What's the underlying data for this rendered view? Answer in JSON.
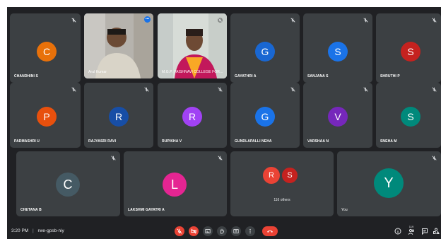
{
  "participants": [
    {
      "name": "CHANDHINI S",
      "initial": "C",
      "color": "#e8710a"
    },
    {
      "name": "Arul Kumar",
      "video": true
    },
    {
      "name": "M.G.P. VAISHNAVI COLLEGE FOR...",
      "video": true
    },
    {
      "name": "GAYATHRI A",
      "initial": "G",
      "color": "#1967d2"
    },
    {
      "name": "SANJANA S",
      "initial": "S",
      "color": "#1a73e8"
    },
    {
      "name": "SHRUTHI P",
      "initial": "S",
      "color": "#c5221f"
    },
    {
      "name": "PADMASHRI U",
      "initial": "P",
      "color": "#e8500d"
    },
    {
      "name": "RAJYASRI RAVI",
      "initial": "R",
      "color": "#174ea6"
    },
    {
      "name": "RUPIKHA V",
      "initial": "R",
      "color": "#a142f4"
    },
    {
      "name": "GUNDLAPALLI NEHA",
      "initial": "G",
      "color": "#1a73e8"
    },
    {
      "name": "VARSHAA N",
      "initial": "V",
      "color": "#7627bb"
    },
    {
      "name": "SNEHA M",
      "initial": "S",
      "color": "#00897b"
    },
    {
      "name": "CHETANA B",
      "initial": "C",
      "color": "#455a64"
    },
    {
      "name": "LAKSHMI GAYATRI A",
      "initial": "L",
      "color": "#e52592"
    },
    {
      "name": "You",
      "initial": "Y",
      "color": "#00897b"
    }
  ],
  "others": {
    "label": "116 others",
    "initials": [
      "R",
      "S"
    ],
    "colors": [
      "#ea4335",
      "#c5221f"
    ]
  },
  "meeting": {
    "time": "3:20 PM",
    "separator": "|",
    "code": "rwe-gpsb-niy"
  },
  "controls": [
    {
      "icon": "mic-off-icon",
      "style": "red"
    },
    {
      "icon": "camera-off-icon",
      "style": "red"
    },
    {
      "icon": "captions-icon",
      "style": "dark"
    },
    {
      "icon": "raise-hand-icon",
      "style": "dark"
    },
    {
      "icon": "present-screen-icon",
      "style": "dark"
    },
    {
      "icon": "more-options-icon",
      "style": "dark"
    },
    {
      "icon": "leave-call-icon",
      "style": "end"
    }
  ],
  "right_icons": [
    "info-icon",
    "people-icon",
    "chat-icon",
    "activities-icon"
  ],
  "people_count": "119"
}
